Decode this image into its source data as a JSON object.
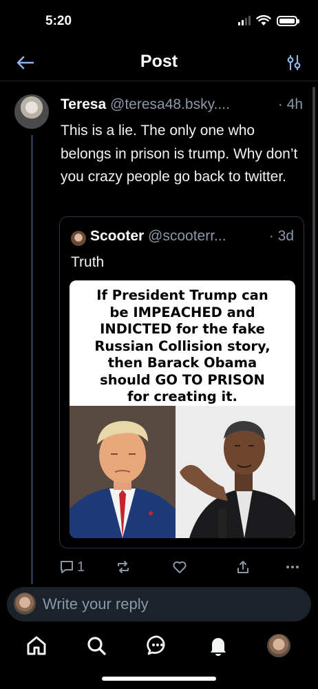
{
  "status_bar": {
    "time": "5:20"
  },
  "header": {
    "title": "Post",
    "back_icon": "arrow-left-icon",
    "filter_icon": "sliders-icon"
  },
  "post": {
    "author_name": "Teresa",
    "author_handle": "@teresa48.bsky....",
    "time": "· 4h",
    "text": "This is a lie. The only one who belongs in prison is trump. Why don’t you crazy people go back to twitter."
  },
  "quote": {
    "author_name": "Scooter",
    "author_handle": "@scooterr...",
    "time": "· 3d",
    "text": "Truth",
    "image_caption_lines": [
      "If President Trump can",
      "be IMPEACHED and",
      "INDICTED for the fake",
      "Russian Collision story,",
      "then Barack Obama",
      "should GO TO PRISON",
      "for creating it."
    ]
  },
  "actions": {
    "reply_count": "1",
    "reply_icon": "comment-icon",
    "repost_icon": "repost-icon",
    "like_icon": "heart-icon",
    "share_icon": "share-icon",
    "more_icon": "more-dots-icon"
  },
  "reply_bar": {
    "placeholder": "Write your reply"
  },
  "tab_bar": {
    "items": [
      "home-icon",
      "search-icon",
      "chat-icon",
      "bell-icon",
      "profile-avatar"
    ]
  },
  "colors": {
    "background": "#000000",
    "muted_text": "#8b98a8",
    "border": "#2a3542",
    "input_bg": "#1b2229"
  }
}
